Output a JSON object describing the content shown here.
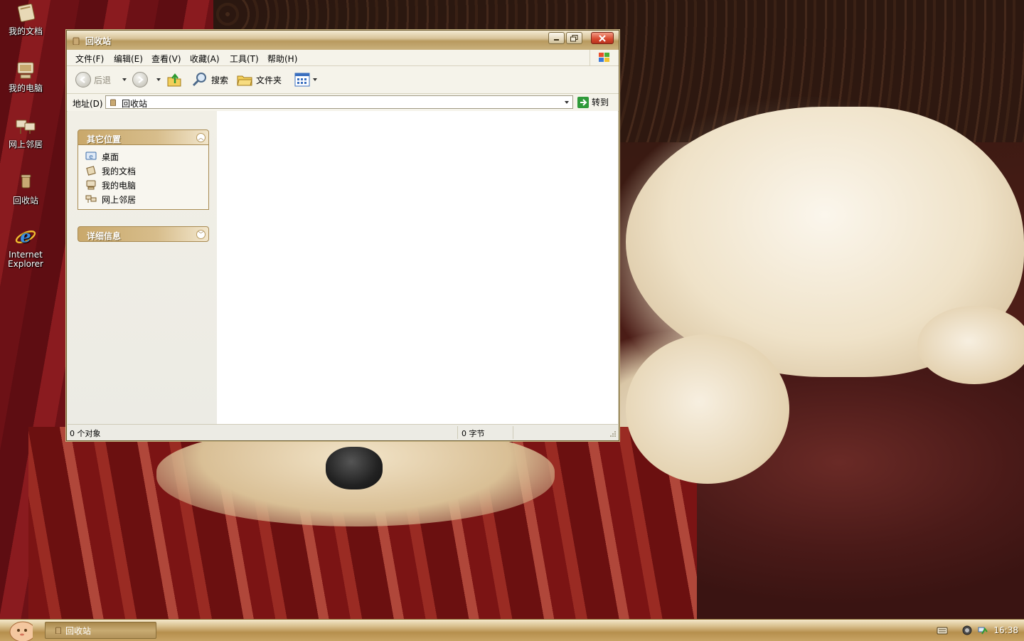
{
  "desktop": {
    "icons": [
      {
        "label": "我的文档",
        "icon": "my-documents-icon"
      },
      {
        "label": "我的电脑",
        "icon": "my-computer-icon"
      },
      {
        "label": "网上邻居",
        "icon": "network-places-icon"
      },
      {
        "label": "回收站",
        "icon": "recycle-bin-icon"
      },
      {
        "label": "Internet Explorer",
        "icon": "internet-explorer-icon"
      }
    ]
  },
  "window": {
    "title": "回收站",
    "menu": [
      "文件(F)",
      "编辑(E)",
      "查看(V)",
      "收藏(A)",
      "工具(T)",
      "帮助(H)"
    ],
    "toolbar": {
      "back": "后退",
      "search": "搜索",
      "folders": "文件夹"
    },
    "address": {
      "label": "地址(D)",
      "value": "回收站",
      "go": "转到"
    },
    "taskpane": {
      "other_places": {
        "title": "其它位置",
        "links": [
          "桌面",
          "我的文档",
          "我的电脑",
          "网上邻居"
        ]
      },
      "details": {
        "title": "详细信息"
      }
    },
    "status": {
      "objects": "0 个对象",
      "size": "0 字节"
    }
  },
  "taskbar": {
    "task_label": "回收站",
    "clock": "16:38"
  },
  "colors": {
    "accent": "#c9a86b",
    "titlebar": "#b89a5f",
    "close": "#d6472d"
  }
}
